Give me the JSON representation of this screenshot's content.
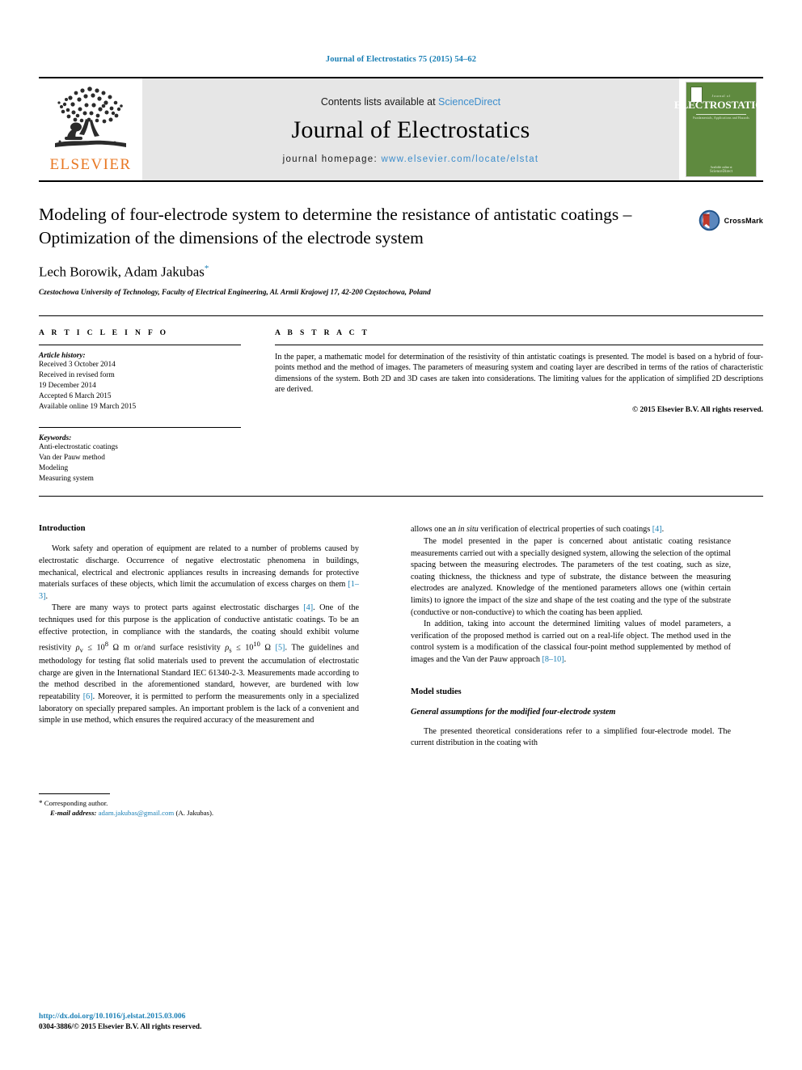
{
  "running_head": "Journal of Electrostatics 75 (2015) 54–62",
  "masthead": {
    "contents_prefix": "Contents lists available at ",
    "sciencedirect": "ScienceDirect",
    "journal_name": "Journal of Electrostatics",
    "homepage_prefix": "journal homepage: ",
    "homepage_url": "www.elsevier.com/locate/elstat",
    "publisher_word": "ELSEVIER",
    "publisher_icon": "elsevier-tree-icon",
    "cover": {
      "overline": "Journal of",
      "title": "ELECTROSTATICS",
      "subtitle": "Fundamentals, Applications and Hazards",
      "footer_small": "Available online at",
      "footer_brand": "ScienceDirect"
    }
  },
  "article": {
    "title": "Modeling of four-electrode system to determine the resistance of antistatic coatings – Optimization of the dimensions of the electrode system",
    "authors": "Lech Borowik, Adam Jakubas",
    "corresponding_marker": "*",
    "affiliation": "Czestochowa University of Technology, Faculty of Electrical Engineering, Al. Armii Krajowej 17, 42-200 Częstochowa, Poland",
    "crossmark_label": "CrossMark",
    "crossmark_icon": "crossmark-icon"
  },
  "info": {
    "heading": "A R T I C L E  I N F O",
    "history_label": "Article history:",
    "history": [
      "Received 3 October 2014",
      "Received in revised form",
      "19 December 2014",
      "Accepted 6 March 2015",
      "Available online 19 March 2015"
    ],
    "keywords_label": "Keywords:",
    "keywords": [
      "Anti-electrostatic coatings",
      "Van der Pauw method",
      "Modeling",
      "Measuring system"
    ]
  },
  "abstract": {
    "heading": "A B S T R A C T",
    "text": "In the paper, a mathematic model for determination of the resistivity of thin antistatic coatings is presented. The model is based on a hybrid of four-points method and the method of images. The parameters of measuring system and coating layer are described in terms of the ratios of characteristic dimensions of the system. Both 2D and 3D cases are taken into considerations. The limiting values for the application of simplified 2D descriptions are derived.",
    "copyright": "© 2015 Elsevier B.V. All rights reserved."
  },
  "body": {
    "intro_heading": "Introduction",
    "left": {
      "p1_a": "Work safety and operation of equipment are related to a number of problems caused by electrostatic discharge. Occurrence of negative electrostatic phenomena in buildings, mechanical, electrical and electronic appliances results in increasing demands for protective materials surfaces of these objects, which limit the accumulation of excess charges on them ",
      "p1_cite": "[1–3]",
      "p1_b": ".",
      "p2_a": "There are many ways to protect parts against electrostatic discharges ",
      "p2_cite1": "[4]",
      "p2_b": ". One of the techniques used for this purpose is the application of conductive antistatic coatings. To be an effective protection, in compliance with the standards, the coating should exhibit volume resistivity ",
      "p2_math1": "ρ",
      "p2_math1_sub": "v",
      "p2_math1_rest": " ≤ 10",
      "p2_math1_sup": "8",
      "p2_math1_unit": " Ω m or/and surface resistivity ",
      "p2_math2": "ρ",
      "p2_math2_sub": "s",
      "p2_math2_rest": " ≤ 10",
      "p2_math2_sup": "10",
      "p2_math2_unit": " Ω ",
      "p2_cite2": "[5]",
      "p2_c": ". The guidelines and methodology for testing flat solid materials used to prevent the accumulation of electrostatic charge are given in the International Standard IEC 61340-2-3. Measurements made according to the method described in the aforementioned standard, however, are burdened with low repeatability ",
      "p2_cite3": "[6]",
      "p2_d": ". Moreover, it is permitted to perform the measurements only in a specialized laboratory on specially prepared samples. An important problem is the lack of a convenient and simple in use method, which ensures the required accuracy of the measurement and"
    },
    "right": {
      "p_cont_a": "allows one an ",
      "p_cont_em": "in situ",
      "p_cont_b": " verification of electrical properties of such coatings ",
      "p_cont_cite": "[4]",
      "p_cont_c": ".",
      "p3": "The model presented in the paper is concerned about antistatic coating resistance measurements carried out with a specially designed system, allowing the selection of the optimal spacing between the measuring electrodes. The parameters of the test coating, such as size, coating thickness, the thickness and type of substrate, the distance between the measuring electrodes are analyzed. Knowledge of the mentioned parameters allows one (within certain limits) to ignore the impact of the size and shape of the test coating and the type of the substrate (conductive or non-conductive) to which the coating has been applied.",
      "p4_a": "In addition, taking into account the determined limiting values of model parameters, a verification of the proposed method is carried out on a real-life object. The method used in the control system is a modification of the classical four-point method supplemented by method of images and the Van der Pauw approach ",
      "p4_cite": "[8–10]",
      "p4_b": ".",
      "model_heading": "Model studies",
      "model_sub": "General assumptions for the modified four-electrode system",
      "p5": "The presented theoretical considerations refer to a simplified four-electrode model. The current distribution in the coating with"
    }
  },
  "footnote": {
    "star": "*",
    "corresponding": " Corresponding author.",
    "email_label": "E-mail address:",
    "email": "adam.jakubas@gmail.com",
    "email_suffix": " (A. Jakubas)."
  },
  "footer": {
    "doi": "http://dx.doi.org/10.1016/j.elstat.2015.03.006",
    "issn": "0304-3886/© 2015 Elsevier B.V. All rights reserved."
  },
  "colors": {
    "link_blue": "#1a7fb5",
    "sciencedirect_blue": "#3c8dcc",
    "elsevier_orange": "#E87722",
    "cover_green": "#5f8a3f",
    "masthead_grey": "#e6e6e6"
  }
}
